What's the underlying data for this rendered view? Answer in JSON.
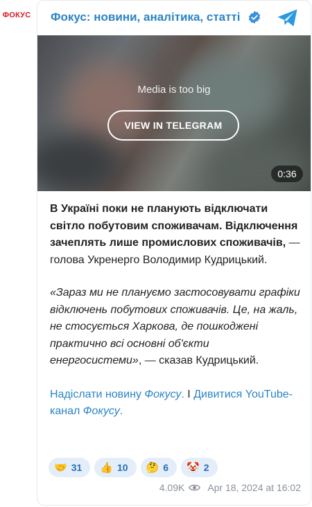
{
  "channel": {
    "avatar_text": "ФОКУС",
    "name": "Фокус: новини, аналітика, статті"
  },
  "media": {
    "caption": "Media is too big",
    "button_label": "VIEW IN TELEGRAM",
    "duration": "0:36"
  },
  "post": {
    "bold_text": "В Україні поки не планують відключати світло побутовим споживачам. Відключення зачеплять лише промислових споживачів,",
    "plain_text_1": " — голова Укренерго Володимир Кудрицький.",
    "quote_italic": "«Зараз ми не плануємо застосовувати графіки відключень побутових споживачів. Це, на жаль, не стосується Харкова, де пошкоджені практично всі основні об'єкти енергосистеми»",
    "plain_text_2": ", — сказав Кудрицький.",
    "link1_a": "Надіслати новину ",
    "link1_b": "Фокусу",
    "link1_c": ".",
    "separator": " І ",
    "link2_a": "Дивитися YouTube-канал ",
    "link2_b": "Фокусу",
    "link2_c": "."
  },
  "reactions": [
    {
      "emoji": "🤝",
      "icon": "handshake-icon",
      "count": "31"
    },
    {
      "emoji": "👍",
      "icon": "thumbs-up-icon",
      "count": "10"
    },
    {
      "emoji": "🤔",
      "icon": "thinking-face-icon",
      "count": "6"
    },
    {
      "emoji": "🤡",
      "icon": "clown-face-icon",
      "count": "2"
    }
  ],
  "footer": {
    "views": "4.09K",
    "date": "Apr 18, 2024 at 16:02"
  },
  "colors": {
    "link": "#2a84c4",
    "brand_red": "#d71920",
    "reaction_bg": "#e3eefa"
  }
}
